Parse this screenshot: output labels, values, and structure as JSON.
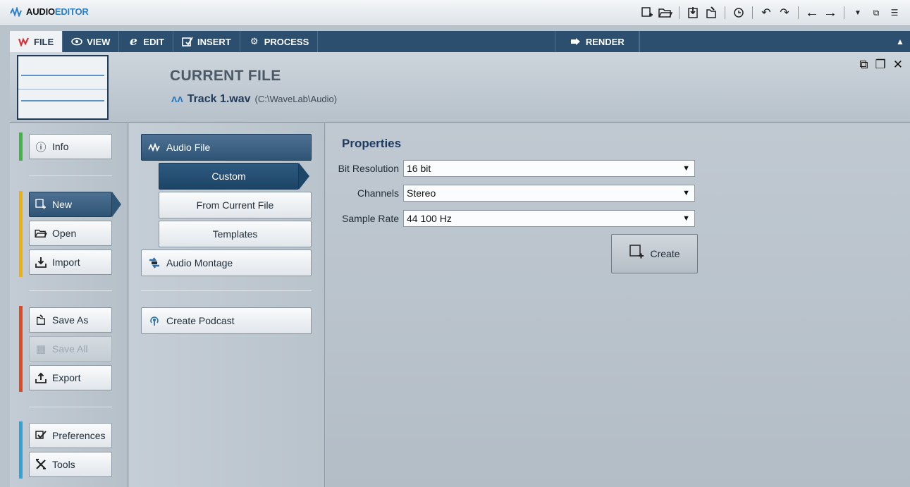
{
  "app": {
    "title_part1": "AUDIO",
    "title_part2": "EDITOR",
    "logo_icon": "waveform-icon"
  },
  "quick_access": [
    "new-file-icon",
    "open-folder-icon",
    "import-icon",
    "save-as-icon",
    "history-icon",
    "undo-icon",
    "redo-icon",
    "back-arrow-icon",
    "forward-arrow-icon",
    "dropdown-icon",
    "restore-window-icon",
    "menu-icon"
  ],
  "tabs": [
    {
      "label": "FILE",
      "icon": "file-wave-icon",
      "active": true
    },
    {
      "label": "VIEW",
      "icon": "eye-icon"
    },
    {
      "label": "EDIT",
      "icon": "edit-e-icon"
    },
    {
      "label": "INSERT",
      "icon": "insert-icon"
    },
    {
      "label": "PROCESS",
      "icon": "gears-icon"
    },
    {
      "label": "RENDER",
      "icon": "render-arrow-icon"
    }
  ],
  "header": {
    "section_title": "CURRENT FILE",
    "file_name": "Track 1.wav",
    "file_path": "(C:\\WaveLab\\Audio)"
  },
  "left_nav": {
    "info": "Info",
    "new": "New",
    "open": "Open",
    "import": "Import",
    "save_as": "Save As",
    "save_all": "Save All",
    "export": "Export",
    "preferences": "Preferences",
    "tools": "Tools"
  },
  "middle_nav": {
    "audio_file": "Audio File",
    "custom": "Custom",
    "from_current": "From Current File",
    "templates": "Templates",
    "audio_montage": "Audio Montage",
    "create_podcast": "Create Podcast"
  },
  "properties": {
    "title": "Properties",
    "bit_resolution_label": "Bit Resolution",
    "bit_resolution_value": "16 bit",
    "channels_label": "Channels",
    "channels_value": "Stereo",
    "sample_rate_label": "Sample Rate",
    "sample_rate_value": "44 100 Hz",
    "create_label": "Create"
  },
  "colors": {
    "accent_green": "#3fb63f",
    "accent_yellow": "#f2b100",
    "accent_red": "#e5481c",
    "accent_blue": "#2ea3d8",
    "ribbon": "#2c4f70",
    "active_nav": "#2e5475"
  }
}
